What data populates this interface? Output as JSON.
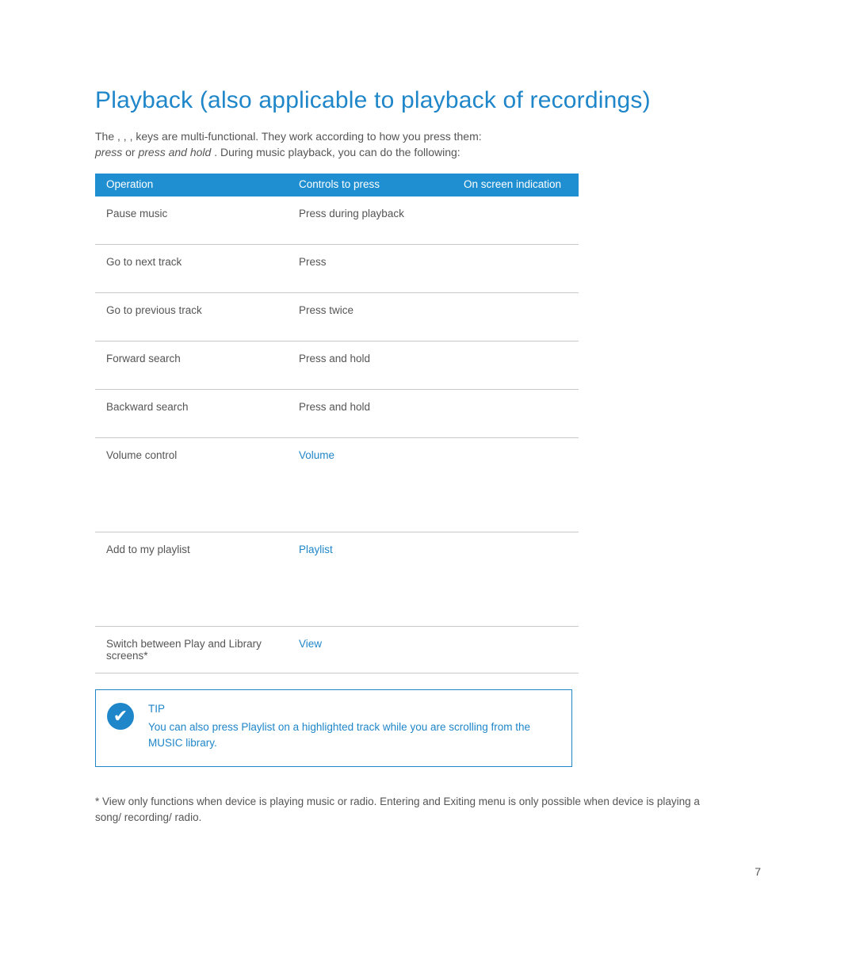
{
  "title": "Playback (also applicable to playback of recordings)",
  "intro": {
    "line1_a": "The ",
    "line1_b": " , ",
    "line1_c": " , ",
    "line1_d": " , ",
    "line1_e": " keys are multi-functional.  They work according to how you press them:",
    "line2_a": "press",
    "line2_b": " or ",
    "line2_c": "press and hold",
    "line2_d": ".  During music playback, you can do the following:"
  },
  "table": {
    "headers": {
      "op": "Operation",
      "ctrl": "Controls to press",
      "scr": "On screen indication"
    },
    "rows": [
      {
        "op": "Pause music",
        "ctrl_pre": "Press ",
        "ctrl_mid": "",
        "ctrl_post": " during playback",
        "h": "row-pause"
      },
      {
        "op": "Go to next track",
        "ctrl_pre": "Press ",
        "ctrl_mid": "",
        "ctrl_post": "",
        "h": "row-std"
      },
      {
        "op": "Go to previous track",
        "ctrl_pre": "Press ",
        "ctrl_mid": "",
        "ctrl_post": " twice",
        "h": "row-std"
      },
      {
        "op": "Forward search",
        "ctrl_pre": "Press and hold ",
        "ctrl_mid": "",
        "ctrl_post": "",
        "h": "row-std"
      },
      {
        "op": "Backward search",
        "ctrl_pre": "Press and hold ",
        "ctrl_mid": "",
        "ctrl_post": "",
        "h": "row-std"
      },
      {
        "op": "Volume control",
        "ctrl_pre": "",
        "ctrl_mid": "Volume",
        "ctrl_post": "",
        "h": "row-mid"
      },
      {
        "op": "Add to my playlist",
        "ctrl_pre": "",
        "ctrl_mid": "Playlist",
        "ctrl_post": "",
        "h": "row-tall"
      },
      {
        "op": "Switch between Play and Library screens*",
        "ctrl_pre": "",
        "ctrl_mid": "View",
        "ctrl_post": "",
        "h": ""
      }
    ]
  },
  "tip": {
    "head": "TIP",
    "body": "You can also press Playlist on a highlighted track while you are scrolling from the MUSIC library."
  },
  "footnote": "* View only functions when device is playing music or radio. Entering and Exiting menu is only possible when device is playing a song/ recording/ radio.",
  "pagenum": "7"
}
